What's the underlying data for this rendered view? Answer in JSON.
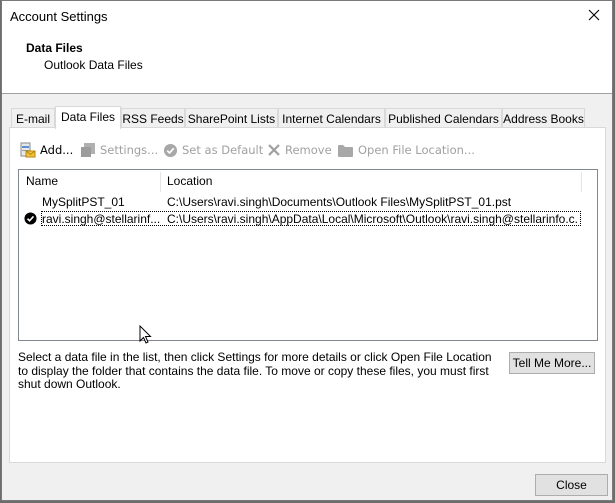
{
  "window": {
    "title": "Account Settings",
    "close_icon": "close-x-icon"
  },
  "header": {
    "heading": "Data Files",
    "subheading": "Outlook Data Files"
  },
  "tabs": [
    {
      "label": "E-mail",
      "active": false
    },
    {
      "label": "Data Files",
      "active": true
    },
    {
      "label": "RSS Feeds",
      "active": false
    },
    {
      "label": "SharePoint Lists",
      "active": false
    },
    {
      "label": "Internet Calendars",
      "active": false
    },
    {
      "label": "Published Calendars",
      "active": false
    },
    {
      "label": "Address Books",
      "active": false
    }
  ],
  "toolbar": {
    "add": {
      "label": "Add...",
      "icon": "add-data-file-icon",
      "enabled": true
    },
    "settings": {
      "label": "Settings...",
      "icon": "settings-icon",
      "enabled": false
    },
    "set_default": {
      "label": "Set as Default",
      "icon": "checkmark-circle-icon",
      "enabled": false
    },
    "remove": {
      "label": "Remove",
      "icon": "x-icon",
      "enabled": false
    },
    "open_location": {
      "label": "Open File Location...",
      "icon": "folder-icon",
      "enabled": false
    }
  },
  "list": {
    "columns": [
      "Name",
      "Location"
    ],
    "rows": [
      {
        "name": "MySplitPST_01",
        "location": "C:\\Users\\ravi.singh\\Documents\\Outlook Files\\MySplitPST_01.pst",
        "default": false,
        "focused": false
      },
      {
        "name": "ravi.singh@stellarinf...",
        "location": "C:\\Users\\ravi.singh\\AppData\\Local\\Microsoft\\Outlook\\ravi.singh@stellarinfo.c...",
        "default": true,
        "focused": true
      }
    ]
  },
  "description": "Select a data file in the list, then click Settings for more details or click Open File Location to display the folder that contains the data file. To move or copy these files, you must first shut down Outlook.",
  "buttons": {
    "tell_me_more": "Tell Me More...",
    "close": "Close"
  }
}
